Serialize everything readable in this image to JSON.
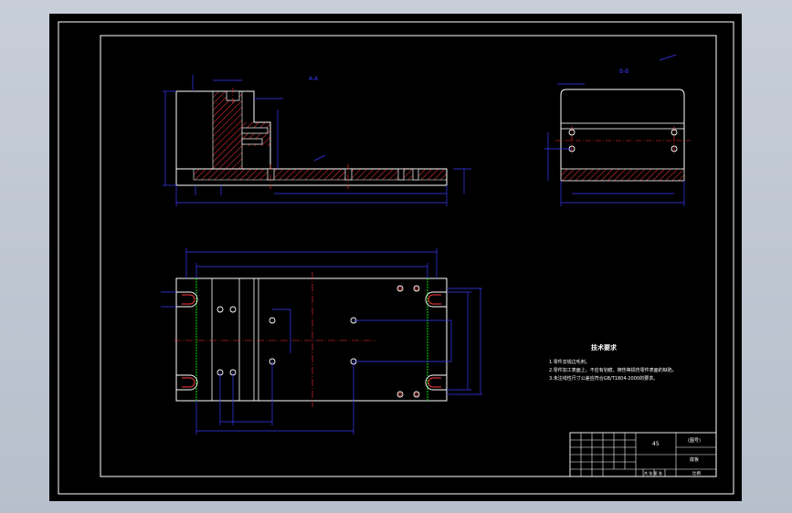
{
  "colors": {
    "background": "#c3cad5",
    "paper": "#000000",
    "border": "#ffffff",
    "outline": "#ffffff",
    "dimension": "#3a3aff",
    "centerline": "#ff3030",
    "hatch": "#ff3a3a",
    "green": "#00c000",
    "text": "#ffffff"
  },
  "section_views": {
    "front_label": "A-A",
    "side_label": "B-B"
  },
  "notes": {
    "title": "技术要求",
    "lines": [
      "1.零件去锐边毛刺。",
      "2.零件加工表面上，不应有划痕、擦伤等损伤零件表面的缺陷。",
      "3.未注线性尺寸公差应符合GB/T1804-2000的要求。"
    ]
  },
  "title_block": {
    "material": "45",
    "drawing_no": "(图号)",
    "name": "底板",
    "scale_label": "比例",
    "sheet_label": "共 张 第 张"
  }
}
